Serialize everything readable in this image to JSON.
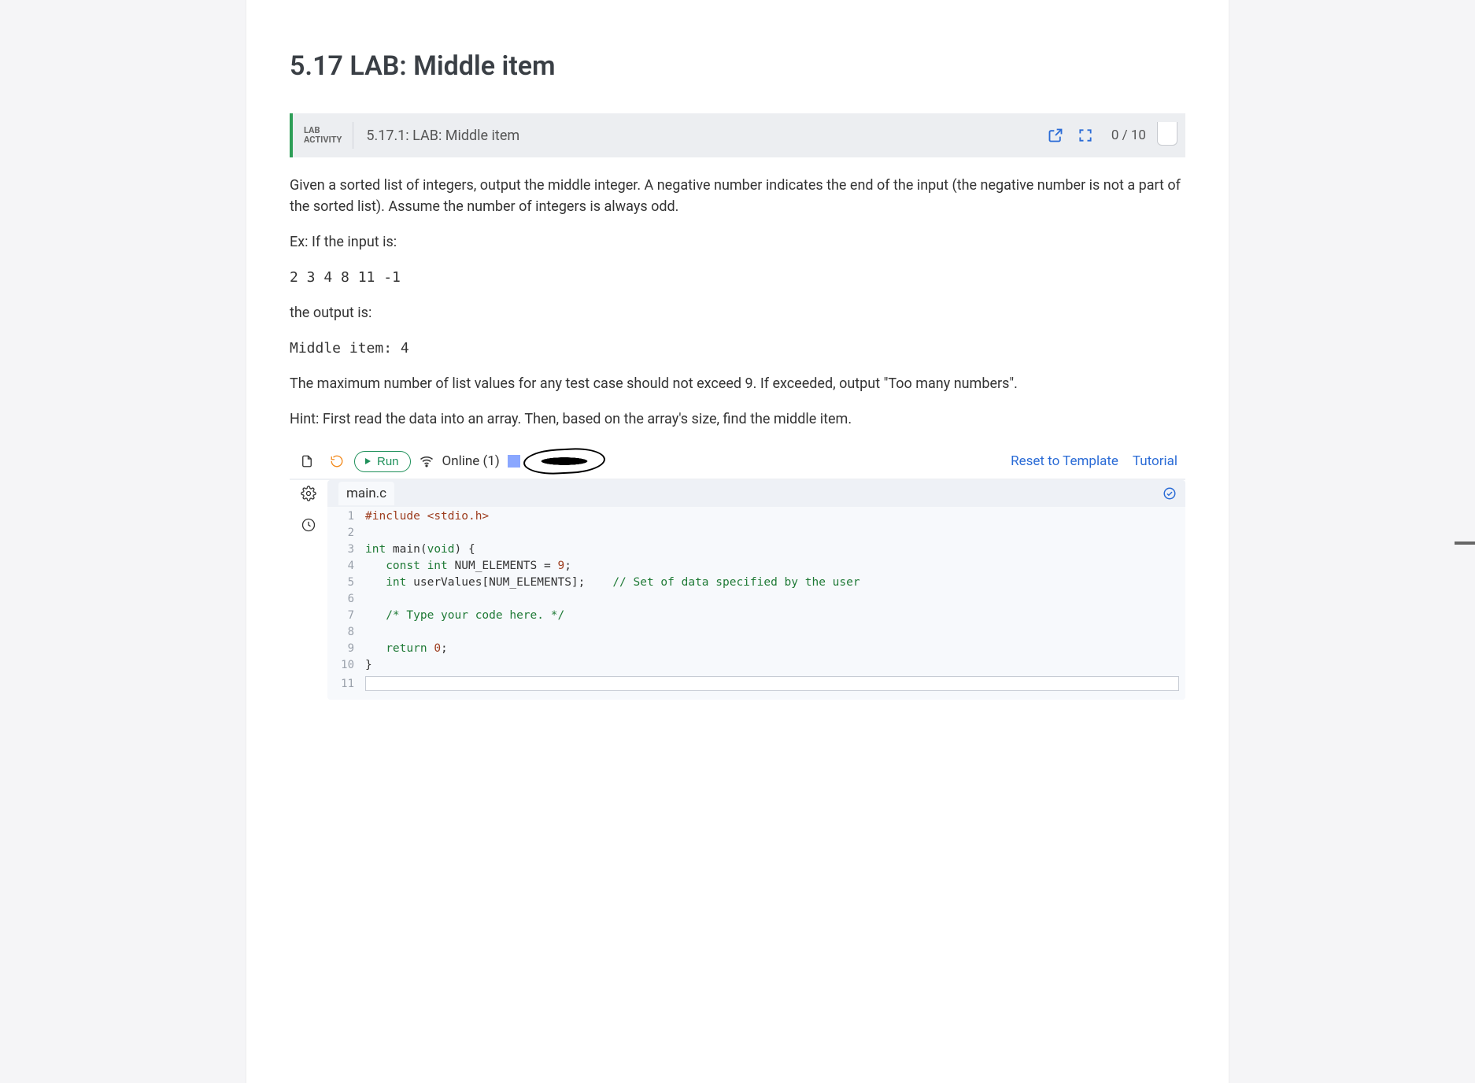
{
  "title": "5.17 LAB: Middle item",
  "activity": {
    "badge_line1": "LAB",
    "badge_line2": "ACTIVITY",
    "title": "5.17.1: LAB: Middle item",
    "score": "0 / 10"
  },
  "description": {
    "p1": "Given a sorted list of integers, output the middle integer. A negative number indicates the end of the input (the negative number is not a part of the sorted list). Assume the number of integers is always odd.",
    "p2": "Ex: If the input is:",
    "input_example": "2 3 4 8 11 -1",
    "p3": "the output is:",
    "output_example": "Middle item: 4",
    "p4": "The maximum number of list values for any test case should not exceed 9. If exceeded, output \"Too many numbers\".",
    "p5": "Hint: First read the data into an array. Then, based on the array's size, find the middle item."
  },
  "toolbar": {
    "run_label": "Run",
    "online_label": "Online (1)",
    "reset_label": "Reset to Template",
    "tutorial_label": "Tutorial"
  },
  "editor": {
    "filename": "main.c",
    "lines": [
      {
        "n": 1,
        "tokens": [
          {
            "t": "#include ",
            "c": "pp"
          },
          {
            "t": "<",
            "c": "lt"
          },
          {
            "t": "stdio.h",
            "c": "hdr"
          },
          {
            "t": ">",
            "c": "lt"
          }
        ]
      },
      {
        "n": 2,
        "tokens": []
      },
      {
        "n": 3,
        "tokens": [
          {
            "t": "int",
            "c": "kw"
          },
          {
            "t": " main(",
            "c": "ident"
          },
          {
            "t": "void",
            "c": "kw"
          },
          {
            "t": ") {",
            "c": "ident"
          }
        ]
      },
      {
        "n": 4,
        "tokens": [
          {
            "t": "   ",
            "c": ""
          },
          {
            "t": "const int",
            "c": "kw"
          },
          {
            "t": " NUM_ELEMENTS = ",
            "c": "ident"
          },
          {
            "t": "9",
            "c": "num"
          },
          {
            "t": ";",
            "c": "ident"
          }
        ]
      },
      {
        "n": 5,
        "tokens": [
          {
            "t": "   ",
            "c": ""
          },
          {
            "t": "int",
            "c": "kw"
          },
          {
            "t": " userValues[NUM_ELEMENTS];    ",
            "c": "ident"
          },
          {
            "t": "// Set of data specified by the user",
            "c": "cmt"
          }
        ]
      },
      {
        "n": 6,
        "tokens": []
      },
      {
        "n": 7,
        "tokens": [
          {
            "t": "   ",
            "c": ""
          },
          {
            "t": "/* Type your code here. */",
            "c": "cmt"
          }
        ]
      },
      {
        "n": 8,
        "tokens": []
      },
      {
        "n": 9,
        "tokens": [
          {
            "t": "   ",
            "c": ""
          },
          {
            "t": "return ",
            "c": "kw"
          },
          {
            "t": "0",
            "c": "num"
          },
          {
            "t": ";",
            "c": "ident"
          }
        ]
      },
      {
        "n": 10,
        "tokens": [
          {
            "t": "}",
            "c": "ident"
          }
        ]
      },
      {
        "n": 11,
        "tokens": [],
        "cursor": true
      }
    ]
  }
}
